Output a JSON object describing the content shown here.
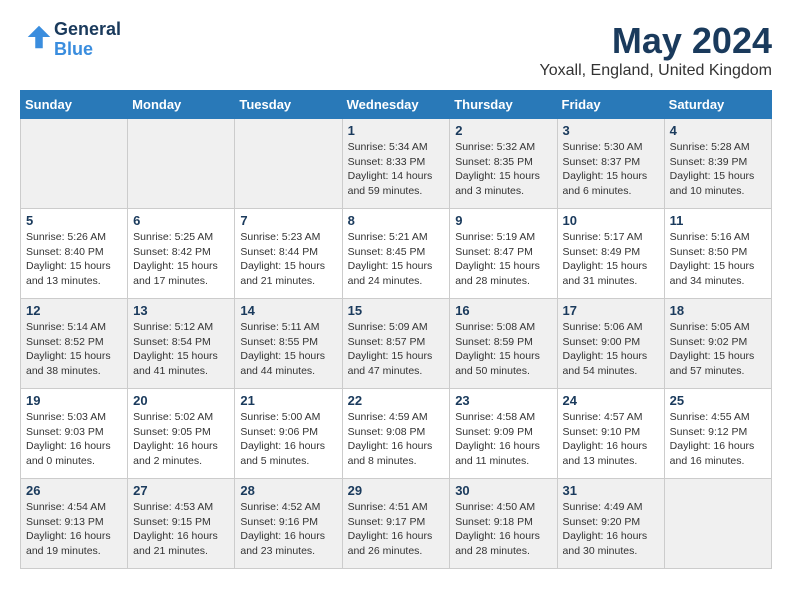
{
  "logo": {
    "line1": "General",
    "line2": "Blue"
  },
  "title": "May 2024",
  "location": "Yoxall, England, United Kingdom",
  "days_of_week": [
    "Sunday",
    "Monday",
    "Tuesday",
    "Wednesday",
    "Thursday",
    "Friday",
    "Saturday"
  ],
  "weeks": [
    [
      {
        "num": "",
        "info": ""
      },
      {
        "num": "",
        "info": ""
      },
      {
        "num": "",
        "info": ""
      },
      {
        "num": "1",
        "info": "Sunrise: 5:34 AM\nSunset: 8:33 PM\nDaylight: 14 hours\nand 59 minutes."
      },
      {
        "num": "2",
        "info": "Sunrise: 5:32 AM\nSunset: 8:35 PM\nDaylight: 15 hours\nand 3 minutes."
      },
      {
        "num": "3",
        "info": "Sunrise: 5:30 AM\nSunset: 8:37 PM\nDaylight: 15 hours\nand 6 minutes."
      },
      {
        "num": "4",
        "info": "Sunrise: 5:28 AM\nSunset: 8:39 PM\nDaylight: 15 hours\nand 10 minutes."
      }
    ],
    [
      {
        "num": "5",
        "info": "Sunrise: 5:26 AM\nSunset: 8:40 PM\nDaylight: 15 hours\nand 13 minutes."
      },
      {
        "num": "6",
        "info": "Sunrise: 5:25 AM\nSunset: 8:42 PM\nDaylight: 15 hours\nand 17 minutes."
      },
      {
        "num": "7",
        "info": "Sunrise: 5:23 AM\nSunset: 8:44 PM\nDaylight: 15 hours\nand 21 minutes."
      },
      {
        "num": "8",
        "info": "Sunrise: 5:21 AM\nSunset: 8:45 PM\nDaylight: 15 hours\nand 24 minutes."
      },
      {
        "num": "9",
        "info": "Sunrise: 5:19 AM\nSunset: 8:47 PM\nDaylight: 15 hours\nand 28 minutes."
      },
      {
        "num": "10",
        "info": "Sunrise: 5:17 AM\nSunset: 8:49 PM\nDaylight: 15 hours\nand 31 minutes."
      },
      {
        "num": "11",
        "info": "Sunrise: 5:16 AM\nSunset: 8:50 PM\nDaylight: 15 hours\nand 34 minutes."
      }
    ],
    [
      {
        "num": "12",
        "info": "Sunrise: 5:14 AM\nSunset: 8:52 PM\nDaylight: 15 hours\nand 38 minutes."
      },
      {
        "num": "13",
        "info": "Sunrise: 5:12 AM\nSunset: 8:54 PM\nDaylight: 15 hours\nand 41 minutes."
      },
      {
        "num": "14",
        "info": "Sunrise: 5:11 AM\nSunset: 8:55 PM\nDaylight: 15 hours\nand 44 minutes."
      },
      {
        "num": "15",
        "info": "Sunrise: 5:09 AM\nSunset: 8:57 PM\nDaylight: 15 hours\nand 47 minutes."
      },
      {
        "num": "16",
        "info": "Sunrise: 5:08 AM\nSunset: 8:59 PM\nDaylight: 15 hours\nand 50 minutes."
      },
      {
        "num": "17",
        "info": "Sunrise: 5:06 AM\nSunset: 9:00 PM\nDaylight: 15 hours\nand 54 minutes."
      },
      {
        "num": "18",
        "info": "Sunrise: 5:05 AM\nSunset: 9:02 PM\nDaylight: 15 hours\nand 57 minutes."
      }
    ],
    [
      {
        "num": "19",
        "info": "Sunrise: 5:03 AM\nSunset: 9:03 PM\nDaylight: 16 hours\nand 0 minutes."
      },
      {
        "num": "20",
        "info": "Sunrise: 5:02 AM\nSunset: 9:05 PM\nDaylight: 16 hours\nand 2 minutes."
      },
      {
        "num": "21",
        "info": "Sunrise: 5:00 AM\nSunset: 9:06 PM\nDaylight: 16 hours\nand 5 minutes."
      },
      {
        "num": "22",
        "info": "Sunrise: 4:59 AM\nSunset: 9:08 PM\nDaylight: 16 hours\nand 8 minutes."
      },
      {
        "num": "23",
        "info": "Sunrise: 4:58 AM\nSunset: 9:09 PM\nDaylight: 16 hours\nand 11 minutes."
      },
      {
        "num": "24",
        "info": "Sunrise: 4:57 AM\nSunset: 9:10 PM\nDaylight: 16 hours\nand 13 minutes."
      },
      {
        "num": "25",
        "info": "Sunrise: 4:55 AM\nSunset: 9:12 PM\nDaylight: 16 hours\nand 16 minutes."
      }
    ],
    [
      {
        "num": "26",
        "info": "Sunrise: 4:54 AM\nSunset: 9:13 PM\nDaylight: 16 hours\nand 19 minutes."
      },
      {
        "num": "27",
        "info": "Sunrise: 4:53 AM\nSunset: 9:15 PM\nDaylight: 16 hours\nand 21 minutes."
      },
      {
        "num": "28",
        "info": "Sunrise: 4:52 AM\nSunset: 9:16 PM\nDaylight: 16 hours\nand 23 minutes."
      },
      {
        "num": "29",
        "info": "Sunrise: 4:51 AM\nSunset: 9:17 PM\nDaylight: 16 hours\nand 26 minutes."
      },
      {
        "num": "30",
        "info": "Sunrise: 4:50 AM\nSunset: 9:18 PM\nDaylight: 16 hours\nand 28 minutes."
      },
      {
        "num": "31",
        "info": "Sunrise: 4:49 AM\nSunset: 9:20 PM\nDaylight: 16 hours\nand 30 minutes."
      },
      {
        "num": "",
        "info": ""
      }
    ]
  ],
  "shaded_weeks": [
    0,
    2,
    4
  ],
  "accent_color": "#2979b8"
}
